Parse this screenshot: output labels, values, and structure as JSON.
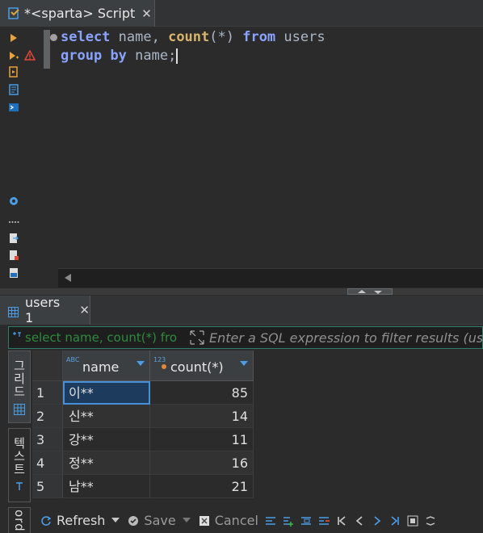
{
  "editor_tab": {
    "title": "*<sparta> Script",
    "close": "✕"
  },
  "editor": {
    "line1": {
      "kw1": "select",
      "t1": " name, ",
      "fn1": "count",
      "t2": "(*) ",
      "kw2": "from",
      "t3": " users"
    },
    "line2": {
      "kw1": "group",
      "t1": " ",
      "kw2": "by",
      "t2": " name;"
    }
  },
  "results_tab": {
    "title": "users 1",
    "close": "✕"
  },
  "filter": {
    "query": "select name, count(*) fro",
    "placeholder": "Enter a SQL expression to filter results (use"
  },
  "vertical_tabs": {
    "grid": "그리드",
    "text": "텍스트",
    "record": "ord"
  },
  "grid": {
    "columns": [
      {
        "type": "ABC",
        "label": "name"
      },
      {
        "type": "123",
        "label": "count(*)"
      }
    ],
    "rows": [
      {
        "num": "1",
        "name": "이**",
        "count": "85"
      },
      {
        "num": "2",
        "name": "신**",
        "count": "14"
      },
      {
        "num": "3",
        "name": "강**",
        "count": "11"
      },
      {
        "num": "4",
        "name": "정**",
        "count": "16"
      },
      {
        "num": "5",
        "name": "남**",
        "count": "21"
      }
    ]
  },
  "toolbar": {
    "refresh": "Refresh",
    "save": "Save",
    "cancel": "Cancel"
  },
  "colors": {
    "keyword": "#8aa3ff",
    "function": "#d9b56b",
    "filter_text": "#2e8b3e",
    "selection": "#1d3b5c"
  }
}
